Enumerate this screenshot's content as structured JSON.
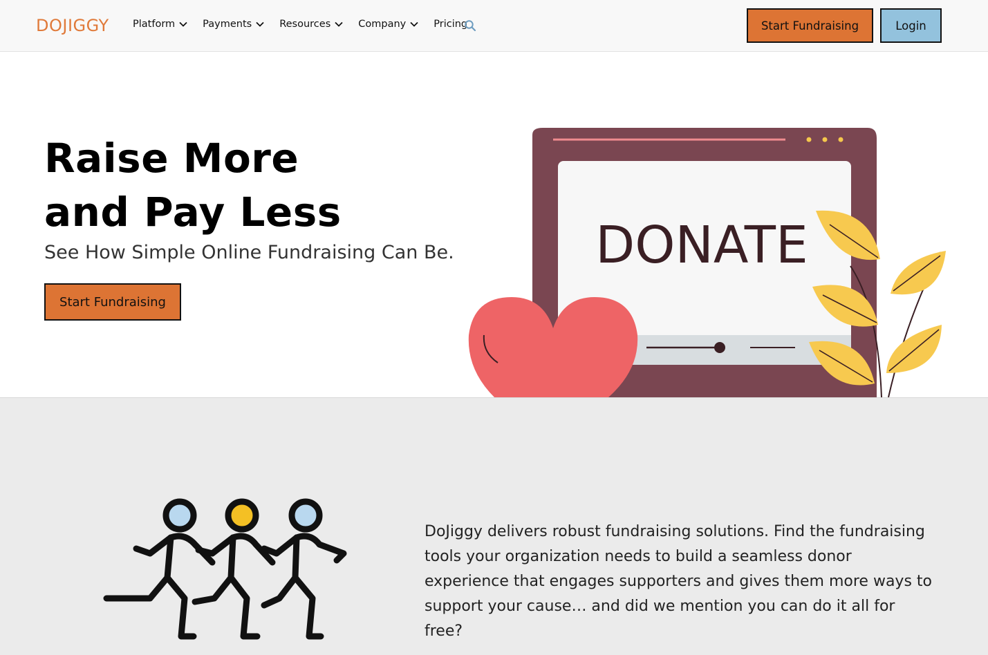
{
  "nav": {
    "logo": "DOJIGGY",
    "items": [
      {
        "label": "Platform",
        "has_dropdown": true
      },
      {
        "label": "Payments",
        "has_dropdown": true
      },
      {
        "label": "Resources",
        "has_dropdown": true
      },
      {
        "label": "Company",
        "has_dropdown": true
      },
      {
        "label": "Pricing",
        "has_dropdown": false
      }
    ],
    "search_icon": "search-icon",
    "start_button": "Start Fundraising",
    "login_button": "Login"
  },
  "hero": {
    "title_line1": "Raise More",
    "title_line2": "and Pay Less",
    "subtitle": "See How Simple Online Fundraising Can Be.",
    "cta": "Start Fundraising",
    "illustration_text": "DONATE"
  },
  "section2": {
    "body": "DoJiggy delivers robust fundraising solutions. Find the fundraising tools your organization needs to build a seamless donor experience that engages supporters and gives them more ways to support your cause… and did we mention you can do it all for free?"
  },
  "colors": {
    "accent": "#dd7434",
    "login": "#93c2dd",
    "logo": "#e07a3a",
    "section_bg": "#ebebeb"
  }
}
